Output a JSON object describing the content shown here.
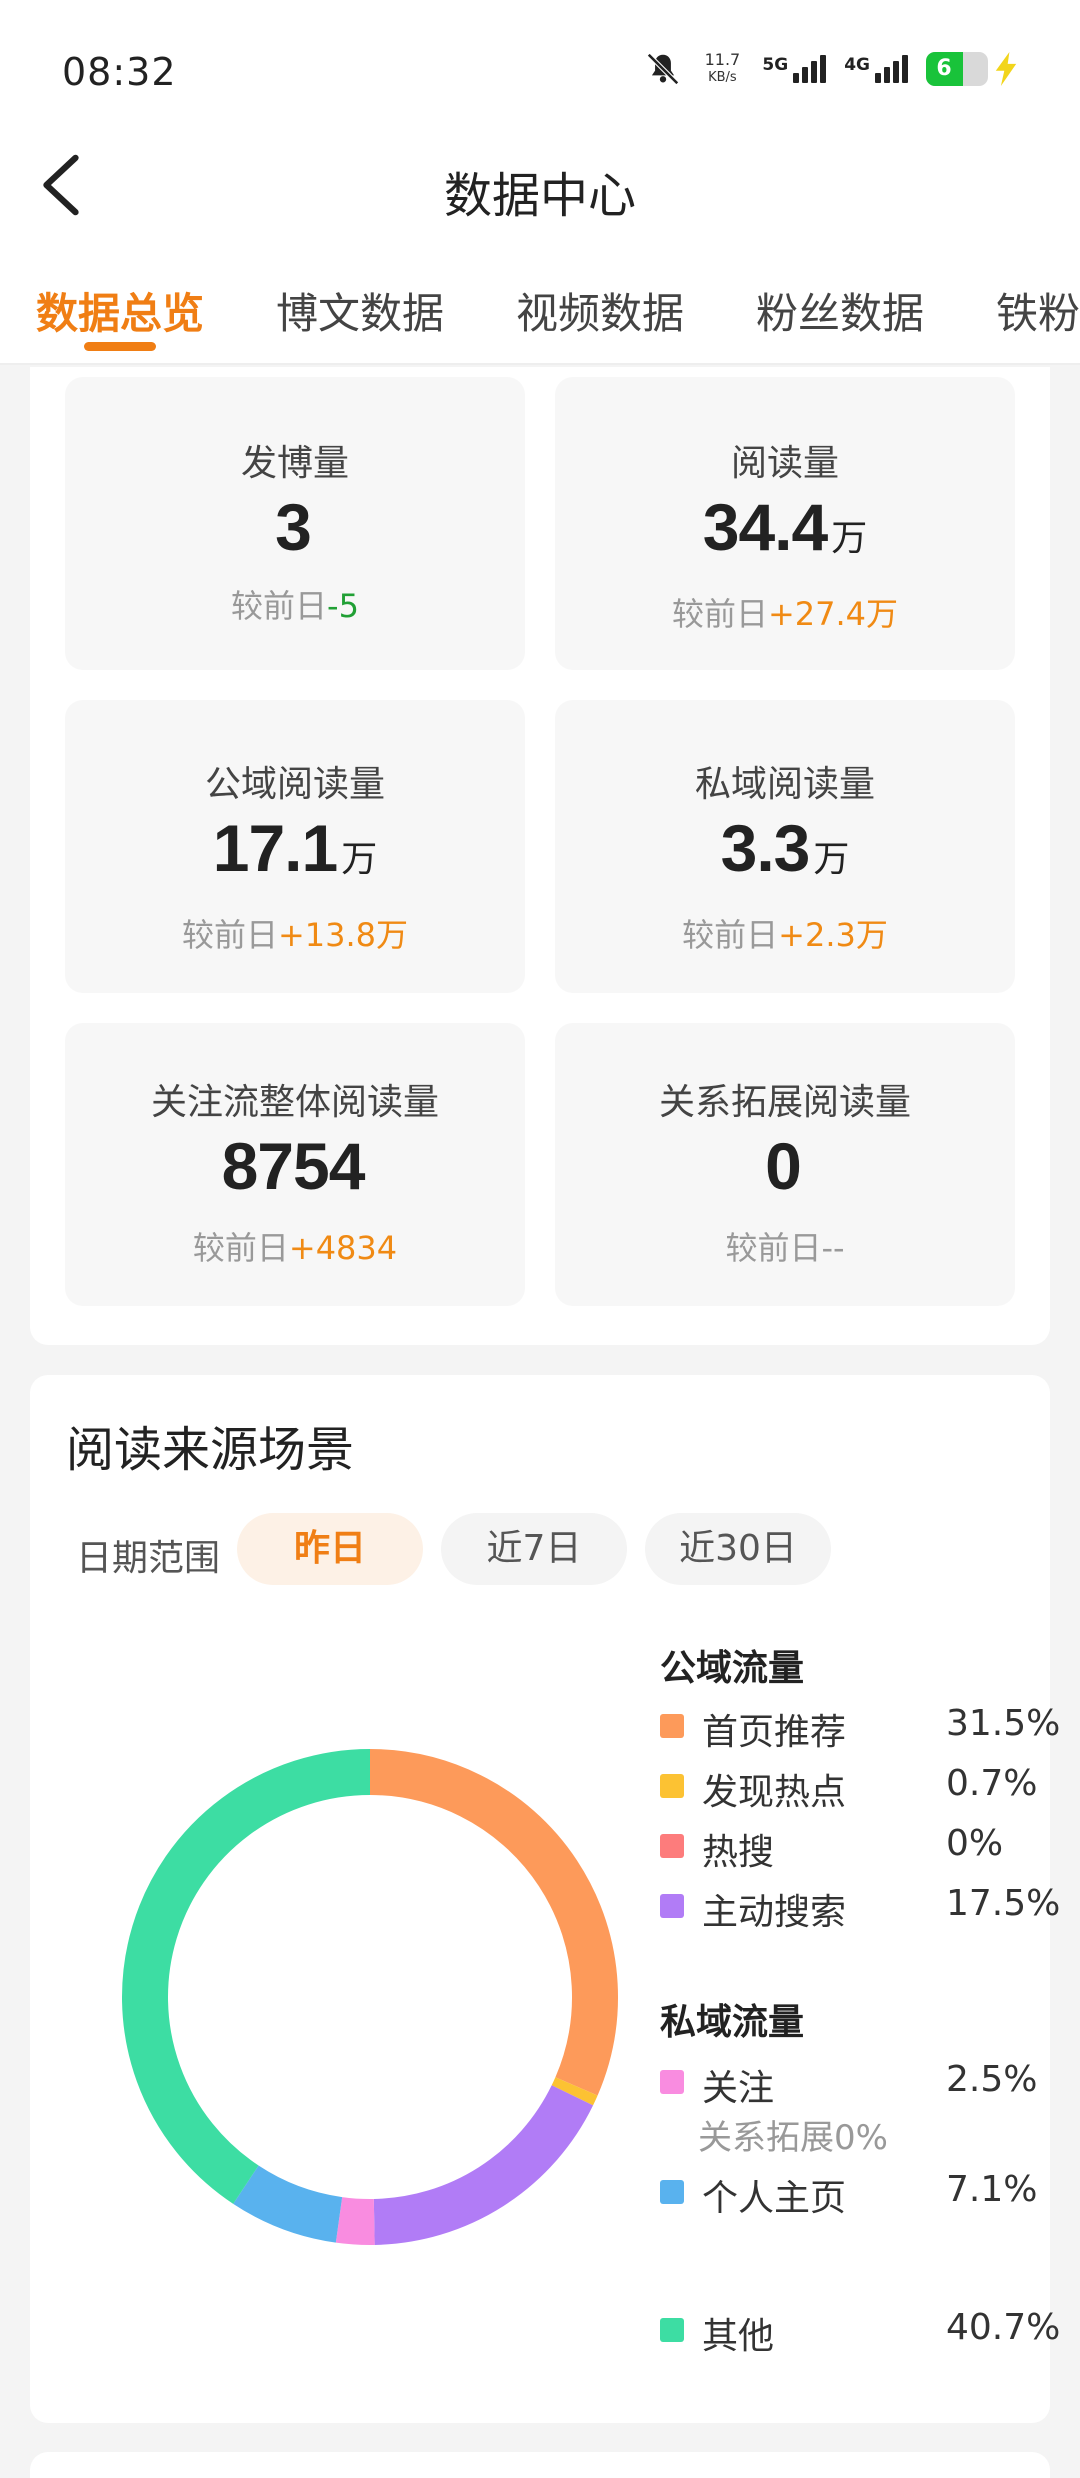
{
  "status_bar": {
    "time": "08:32",
    "speed_value": "11.7",
    "speed_unit": "KB/s",
    "net1": "5G",
    "net2": "4G",
    "battery": "6"
  },
  "nav": {
    "title": "数据中心"
  },
  "tabs": [
    {
      "label": "数据总览",
      "active": true
    },
    {
      "label": "博文数据"
    },
    {
      "label": "视频数据"
    },
    {
      "label": "粉丝数据"
    },
    {
      "label": "铁粉"
    }
  ],
  "stats": [
    {
      "label": "发博量",
      "value": "3",
      "unit": "",
      "change_prefix": "较前日",
      "change": "-5",
      "dir": "down"
    },
    {
      "label": "阅读量",
      "value": "34.4",
      "unit": "万",
      "change_prefix": "较前日",
      "change": "+27.4万",
      "dir": "up"
    },
    {
      "label": "公域阅读量",
      "value": "17.1",
      "unit": "万",
      "change_prefix": "较前日",
      "change": "+13.8万",
      "dir": "up"
    },
    {
      "label": "私域阅读量",
      "value": "3.3",
      "unit": "万",
      "change_prefix": "较前日",
      "change": "+2.3万",
      "dir": "up"
    },
    {
      "label": "关注流整体阅读量",
      "value": "8754",
      "unit": "",
      "change_prefix": "较前日",
      "change": "+4834",
      "dir": "up"
    },
    {
      "label": "关系拓展阅读量",
      "value": "0",
      "unit": "",
      "change_prefix": "较前日",
      "change": "--",
      "dir": "none"
    }
  ],
  "source": {
    "title": "阅读来源场景",
    "range_label": "日期范围",
    "ranges": [
      {
        "label": "昨日",
        "active": true
      },
      {
        "label": "近7日"
      },
      {
        "label": "近30日"
      }
    ],
    "public_group": "公域流量",
    "private_group": "私域流量",
    "sub_note": "关系拓展0%"
  },
  "chart_data": {
    "type": "pie",
    "series": [
      {
        "name": "首页推荐",
        "value": 31.5,
        "label": "31.5%",
        "color": "#fd9a5a",
        "group": "公域流量"
      },
      {
        "name": "发现热点",
        "value": 0.7,
        "label": "0.7%",
        "color": "#fcc233",
        "group": "公域流量"
      },
      {
        "name": "热搜",
        "value": 0,
        "label": "0%",
        "color": "#fd7c7c",
        "group": "公域流量"
      },
      {
        "name": "主动搜索",
        "value": 17.5,
        "label": "17.5%",
        "color": "#b17cf6",
        "group": "公域流量"
      },
      {
        "name": "关注",
        "value": 2.5,
        "label": "2.5%",
        "color": "#f98ce0",
        "group": "私域流量"
      },
      {
        "name": "个人主页",
        "value": 7.1,
        "label": "7.1%",
        "color": "#59b2ee",
        "group": "私域流量"
      },
      {
        "name": "其他",
        "value": 40.7,
        "label": "40.7%",
        "color": "#3ddda3",
        "group": ""
      }
    ]
  }
}
